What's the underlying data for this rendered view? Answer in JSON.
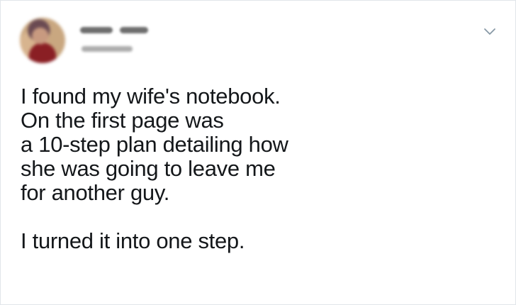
{
  "tweet": {
    "author_avatar": "avatar",
    "menu_icon": "chevron-down-icon",
    "lines": [
      "I found my wife's notebook.",
      "On the first page was",
      "a 10-step plan detailing how",
      "she was going to leave me",
      "for another guy."
    ],
    "punchline": "I turned it into one step."
  },
  "colors": {
    "text": "#14171a",
    "border": "#e1e6ea",
    "chevron": "#8899a6"
  }
}
